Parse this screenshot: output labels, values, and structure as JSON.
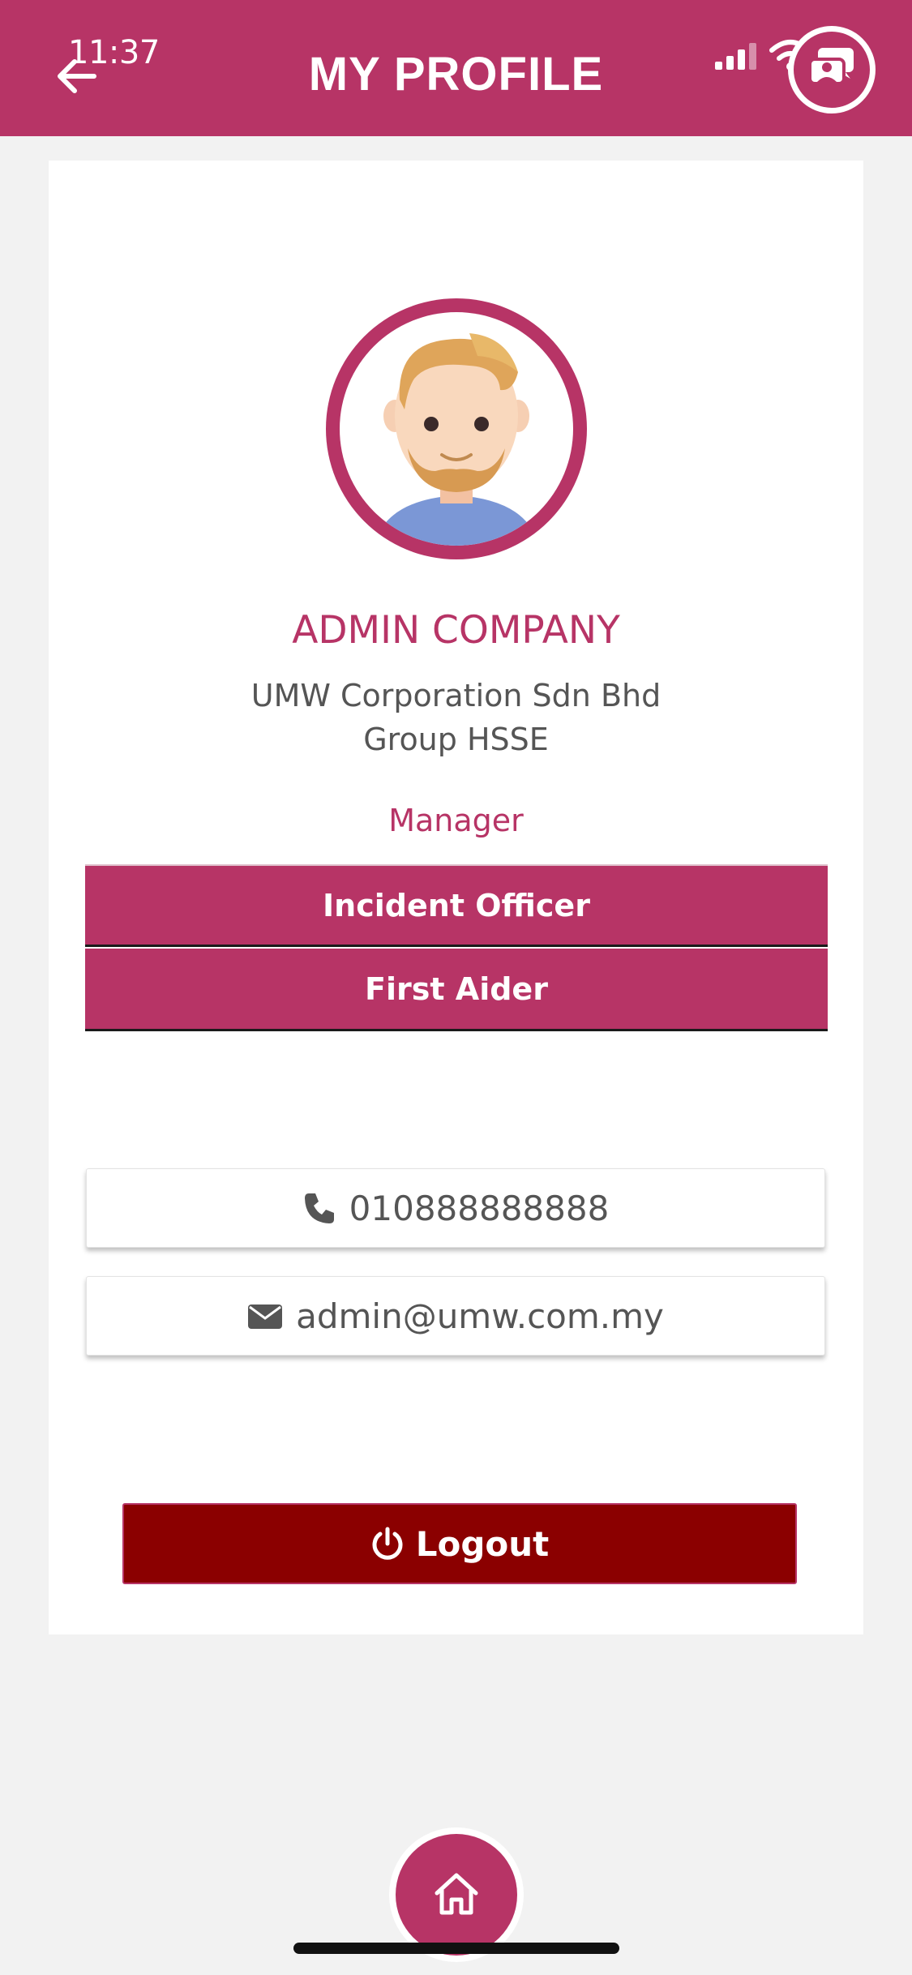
{
  "status_bar": {
    "time": "11:37"
  },
  "header": {
    "title": "MY PROFILE",
    "back_icon": "arrow-left-icon",
    "chat_icon": "chat-bubbles-icon",
    "color": "#b73466"
  },
  "profile": {
    "avatar_icon": "user-avatar-illustration",
    "name": "ADMIN COMPANY",
    "company": "UMW Corporation Sdn Bhd",
    "department": "Group HSSE",
    "position": "Manager",
    "roles": [
      "Incident Officer",
      "First Aider"
    ]
  },
  "contacts": {
    "phone": "010888888888",
    "phone_icon": "phone-icon",
    "email": "admin@umw.com.my",
    "email_icon": "envelope-icon"
  },
  "actions": {
    "logout_label": "Logout",
    "logout_icon": "power-icon",
    "logout_color": "#8b0000"
  },
  "bottom_nav": {
    "home_icon": "home-icon"
  }
}
